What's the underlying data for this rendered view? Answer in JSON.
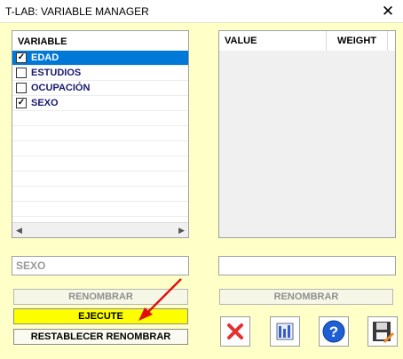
{
  "window": {
    "title": "T-LAB: VARIABLE MANAGER"
  },
  "variables": {
    "header": "VARIABLE",
    "items": [
      {
        "label": "EDAD",
        "checked": true,
        "selected": true
      },
      {
        "label": "ESTUDIOS",
        "checked": false,
        "selected": false
      },
      {
        "label": "OCUPACIÓN",
        "checked": false,
        "selected": false
      },
      {
        "label": "SEXO",
        "checked": true,
        "selected": false
      }
    ]
  },
  "values_panel": {
    "value_header": "VALUE",
    "weight_header": "WEIGHT"
  },
  "left_input": {
    "value": "SEXO"
  },
  "right_input": {
    "value": ""
  },
  "buttons": {
    "rename_left": "RENOMBRAR",
    "rename_right": "RENOMBRAR",
    "execute": "EJECUTE",
    "reset_rename": "RESTABLECER RENOMBRAR"
  },
  "icons": [
    "delete-icon",
    "chart-bars-icon",
    "help-icon",
    "save-icon"
  ],
  "colors": {
    "background": "#ffffc8",
    "execute_button": "#ffff00",
    "selection": "#0078d7"
  }
}
